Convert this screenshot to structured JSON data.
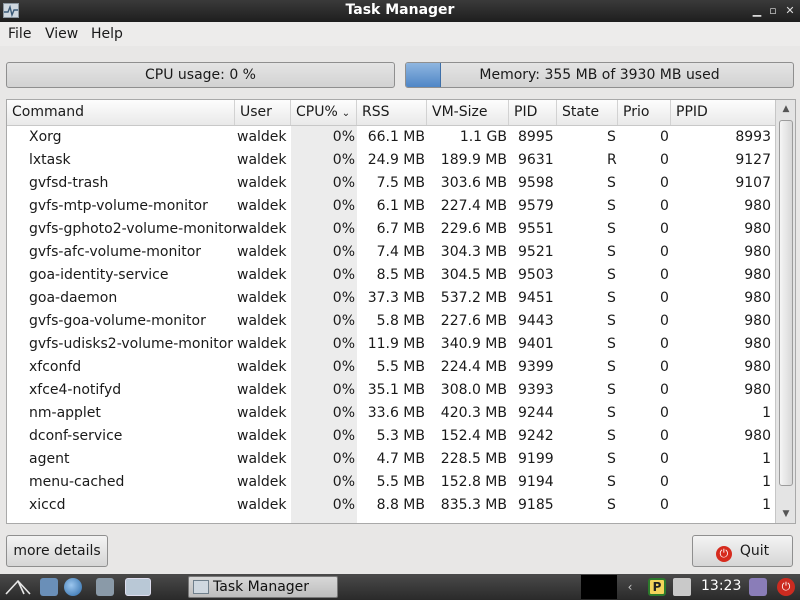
{
  "window": {
    "title": "Task Manager"
  },
  "menu": {
    "file": "File",
    "view": "View",
    "help": "Help"
  },
  "usage": {
    "cpu_label": "CPU usage: 0 %",
    "cpu_fraction": 0.0,
    "memory_label": "Memory: 355 MB of 3930 MB used",
    "memory_fraction": 0.09
  },
  "table": {
    "columns": {
      "command": "Command",
      "user": "User",
      "cpu": "CPU%",
      "rss": "RSS",
      "vmsize": "VM-Size",
      "pid": "PID",
      "state": "State",
      "prio": "Prio",
      "ppid": "PPID"
    },
    "sort_indicator": "chevron-down-icon",
    "rows": [
      {
        "command": "Xorg",
        "user": "waldek",
        "cpu": "0%",
        "rss": "66.1 MB",
        "vmsize": "1.1 GB",
        "pid": "8995",
        "state": "S",
        "prio": "0",
        "ppid": "8993"
      },
      {
        "command": "lxtask",
        "user": "waldek",
        "cpu": "0%",
        "rss": "24.9 MB",
        "vmsize": "189.9 MB",
        "pid": "9631",
        "state": "R",
        "prio": "0",
        "ppid": "9127"
      },
      {
        "command": "gvfsd-trash",
        "user": "waldek",
        "cpu": "0%",
        "rss": "7.5 MB",
        "vmsize": "303.6 MB",
        "pid": "9598",
        "state": "S",
        "prio": "0",
        "ppid": "9107"
      },
      {
        "command": "gvfs-mtp-volume-monitor",
        "user": "waldek",
        "cpu": "0%",
        "rss": "6.1 MB",
        "vmsize": "227.4 MB",
        "pid": "9579",
        "state": "S",
        "prio": "0",
        "ppid": "980"
      },
      {
        "command": "gvfs-gphoto2-volume-monitor",
        "user": "waldek",
        "cpu": "0%",
        "rss": "6.7 MB",
        "vmsize": "229.6 MB",
        "pid": "9551",
        "state": "S",
        "prio": "0",
        "ppid": "980"
      },
      {
        "command": "gvfs-afc-volume-monitor",
        "user": "waldek",
        "cpu": "0%",
        "rss": "7.4 MB",
        "vmsize": "304.3 MB",
        "pid": "9521",
        "state": "S",
        "prio": "0",
        "ppid": "980"
      },
      {
        "command": "goa-identity-service",
        "user": "waldek",
        "cpu": "0%",
        "rss": "8.5 MB",
        "vmsize": "304.5 MB",
        "pid": "9503",
        "state": "S",
        "prio": "0",
        "ppid": "980"
      },
      {
        "command": "goa-daemon",
        "user": "waldek",
        "cpu": "0%",
        "rss": "37.3 MB",
        "vmsize": "537.2 MB",
        "pid": "9451",
        "state": "S",
        "prio": "0",
        "ppid": "980"
      },
      {
        "command": "gvfs-goa-volume-monitor",
        "user": "waldek",
        "cpu": "0%",
        "rss": "5.8 MB",
        "vmsize": "227.6 MB",
        "pid": "9443",
        "state": "S",
        "prio": "0",
        "ppid": "980"
      },
      {
        "command": "gvfs-udisks2-volume-monitor",
        "user": "waldek",
        "cpu": "0%",
        "rss": "11.9 MB",
        "vmsize": "340.9 MB",
        "pid": "9401",
        "state": "S",
        "prio": "0",
        "ppid": "980"
      },
      {
        "command": "xfconfd",
        "user": "waldek",
        "cpu": "0%",
        "rss": "5.5 MB",
        "vmsize": "224.4 MB",
        "pid": "9399",
        "state": "S",
        "prio": "0",
        "ppid": "980"
      },
      {
        "command": "xfce4-notifyd",
        "user": "waldek",
        "cpu": "0%",
        "rss": "35.1 MB",
        "vmsize": "308.0 MB",
        "pid": "9393",
        "state": "S",
        "prio": "0",
        "ppid": "980"
      },
      {
        "command": "nm-applet",
        "user": "waldek",
        "cpu": "0%",
        "rss": "33.6 MB",
        "vmsize": "420.3 MB",
        "pid": "9244",
        "state": "S",
        "prio": "0",
        "ppid": "1"
      },
      {
        "command": "dconf-service",
        "user": "waldek",
        "cpu": "0%",
        "rss": "5.3 MB",
        "vmsize": "152.4 MB",
        "pid": "9242",
        "state": "S",
        "prio": "0",
        "ppid": "980"
      },
      {
        "command": "agent",
        "user": "waldek",
        "cpu": "0%",
        "rss": "4.7 MB",
        "vmsize": "228.5 MB",
        "pid": "9199",
        "state": "S",
        "prio": "0",
        "ppid": "1"
      },
      {
        "command": "menu-cached",
        "user": "waldek",
        "cpu": "0%",
        "rss": "5.5 MB",
        "vmsize": "152.8 MB",
        "pid": "9194",
        "state": "S",
        "prio": "0",
        "ppid": "1"
      },
      {
        "command": "xiccd",
        "user": "waldek",
        "cpu": "0%",
        "rss": "8.8 MB",
        "vmsize": "835.3 MB",
        "pid": "9185",
        "state": "S",
        "prio": "0",
        "ppid": "1"
      }
    ]
  },
  "buttons": {
    "more_details": "more details",
    "quit": "Quit"
  },
  "taskbar": {
    "task_label": "Task Manager",
    "clock": "13:23"
  },
  "colors": {
    "titlebar": "#2a2a2a",
    "progress_fill": "#4f86c6",
    "quit_icon": "#d62b1e",
    "taskbar": "#333333"
  }
}
